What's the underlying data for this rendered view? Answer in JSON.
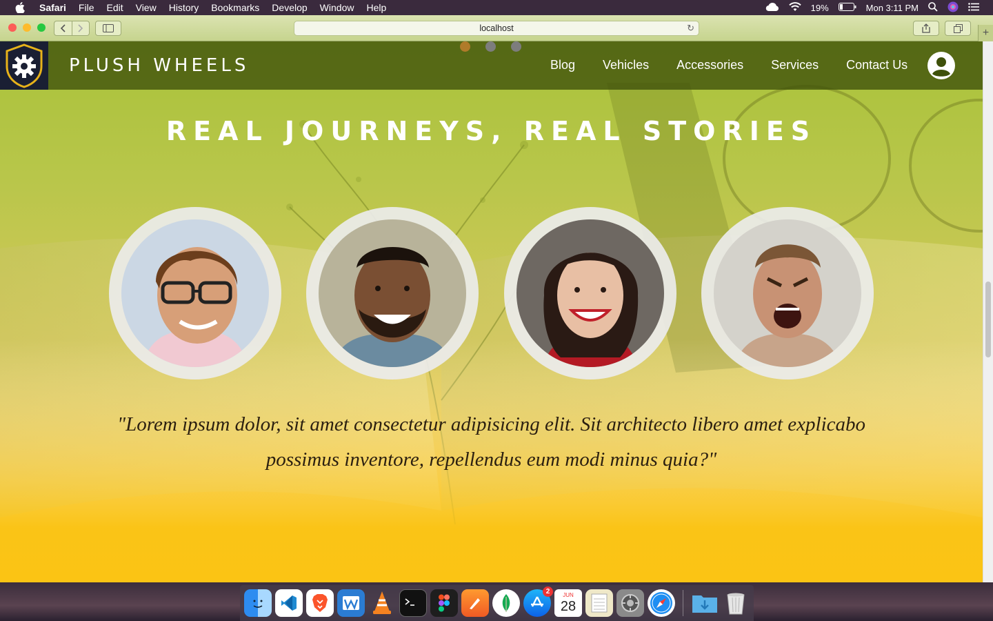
{
  "menubar": {
    "app_name": "Safari",
    "items": [
      "File",
      "Edit",
      "View",
      "History",
      "Bookmarks",
      "Develop",
      "Window",
      "Help"
    ],
    "battery": "19%",
    "clock": "Mon 3:11 PM"
  },
  "browser": {
    "url": "localhost"
  },
  "site": {
    "brand": "PLUSH WHEELS",
    "nav": [
      "Blog",
      "Vehicles",
      "Accessories",
      "Services",
      "Contact Us"
    ],
    "headline": "REAL JOURNEYS, REAL STORIES",
    "carousel_active_index": 0,
    "carousel_count": 3,
    "quote": "\"Lorem ipsum dolor, sit amet consectetur adipisicing elit. Sit architecto libero amet explicabo possimus inventore, repellendus eum modi minus quia?\"",
    "testimonials": [
      {
        "icon": "man-glasses-avatar"
      },
      {
        "icon": "smiling-man-avatar"
      },
      {
        "icon": "smiling-woman-avatar"
      },
      {
        "icon": "shouting-man-avatar"
      }
    ]
  },
  "dock": {
    "apps": [
      "Finder",
      "VS Code",
      "Brave",
      "Word",
      "VLC",
      "Terminal",
      "Figma",
      "Pixelmator",
      "MongoDB Compass",
      "App Store",
      "Calendar",
      "Notes",
      "System Preferences",
      "Safari",
      "Downloads",
      "Trash"
    ],
    "app_store_badge": "2",
    "calendar_month": "JUN",
    "calendar_day": "28"
  },
  "colors": {
    "nav_bg": "#3e500a",
    "logo_bg": "#1a1f33",
    "logo_gold": "#e7b21a",
    "gradient_top": "#a9c23a",
    "gradient_bottom": "#fbc414"
  }
}
